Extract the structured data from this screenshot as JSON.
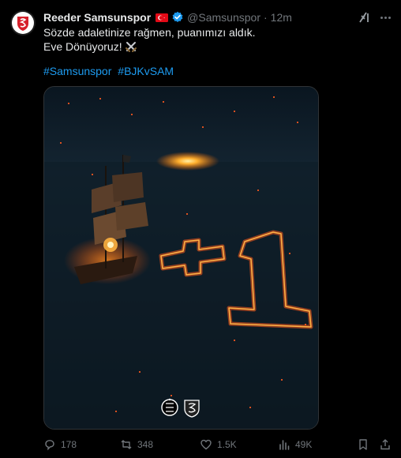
{
  "tweet": {
    "display_name": "Reeder Samsunspor",
    "handle": "@Samsunspor",
    "separator": "·",
    "time": "12m",
    "text_line1": "Sözde adaletinize rağmen, puanımızı aldık.",
    "text_line2": "Eve Dönüyoruz!",
    "hashtags": [
      "#Samsunspor",
      "#BJKvSAM"
    ]
  },
  "icons": {
    "avatar": "samsunspor-logo",
    "flag": "turkey-flag",
    "verified": "verified-badge",
    "grok": "grok-icon",
    "more": "more-icon",
    "swords": "crossed-swords-emoji"
  },
  "image": {
    "description_text": "+1",
    "badges": [
      "besiktas-crest-icon",
      "samsunspor-crest-icon"
    ]
  },
  "actions": {
    "replies": "178",
    "reposts": "348",
    "likes": "1.5K",
    "views": "49K"
  },
  "colors": {
    "background": "#000000",
    "text": "#e7e9ea",
    "muted": "#71767b",
    "link": "#1d9bf0",
    "verified": "#1d9bf0",
    "brand_red": "#d6202b"
  }
}
